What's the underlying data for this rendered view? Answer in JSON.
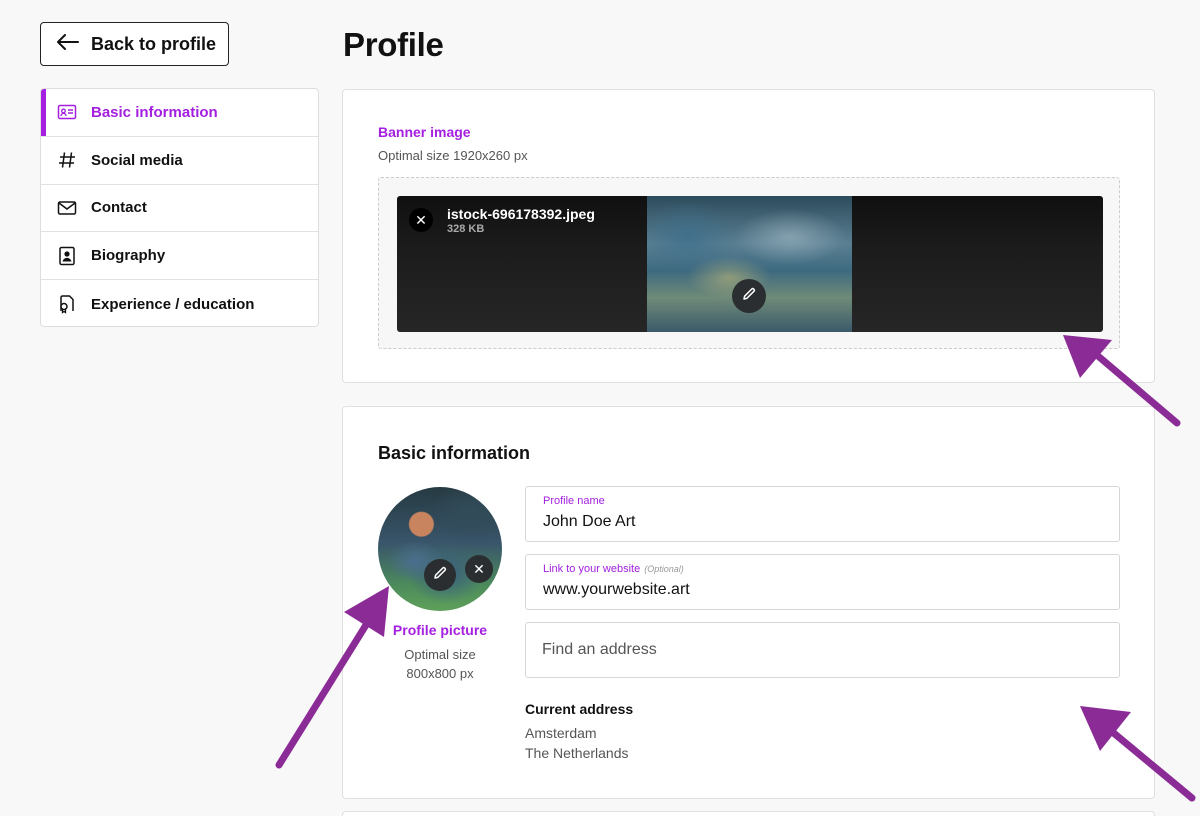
{
  "back_button": {
    "label": "Back to profile",
    "icon": "arrow-left-icon"
  },
  "page_title": "Profile",
  "sidebar": {
    "items": [
      {
        "label": "Basic information",
        "icon": "id-card-icon",
        "active": true
      },
      {
        "label": "Social media",
        "icon": "hashtag-icon",
        "active": false
      },
      {
        "label": "Contact",
        "icon": "envelope-icon",
        "active": false
      },
      {
        "label": "Biography",
        "icon": "portrait-icon",
        "active": false
      },
      {
        "label": "Experience / education",
        "icon": "certificate-icon",
        "active": false
      }
    ]
  },
  "banner": {
    "label": "Banner image",
    "hint": "Optimal size 1920x260 px",
    "file_name": "istock-696178392.jpeg",
    "file_size": "328 KB",
    "remove_glyph": "✕"
  },
  "basic_info": {
    "title": "Basic information",
    "profile_picture": {
      "label": "Profile picture",
      "hint_line1": "Optimal size",
      "hint_line2": "800x800 px",
      "remove_glyph": "✕"
    },
    "profile_name": {
      "label": "Profile name",
      "value": "John Doe Art"
    },
    "website": {
      "label": "Link to your website",
      "optional": "(Optional)",
      "value": "www.yourwebsite.art"
    },
    "address_search": {
      "placeholder": "Find an address",
      "value": ""
    },
    "current_address": {
      "label": "Current address",
      "line1": "Amsterdam",
      "line2": "The Netherlands"
    }
  },
  "colors": {
    "accent": "#a41fe0",
    "annotation_arrow": "#8b2b96"
  }
}
